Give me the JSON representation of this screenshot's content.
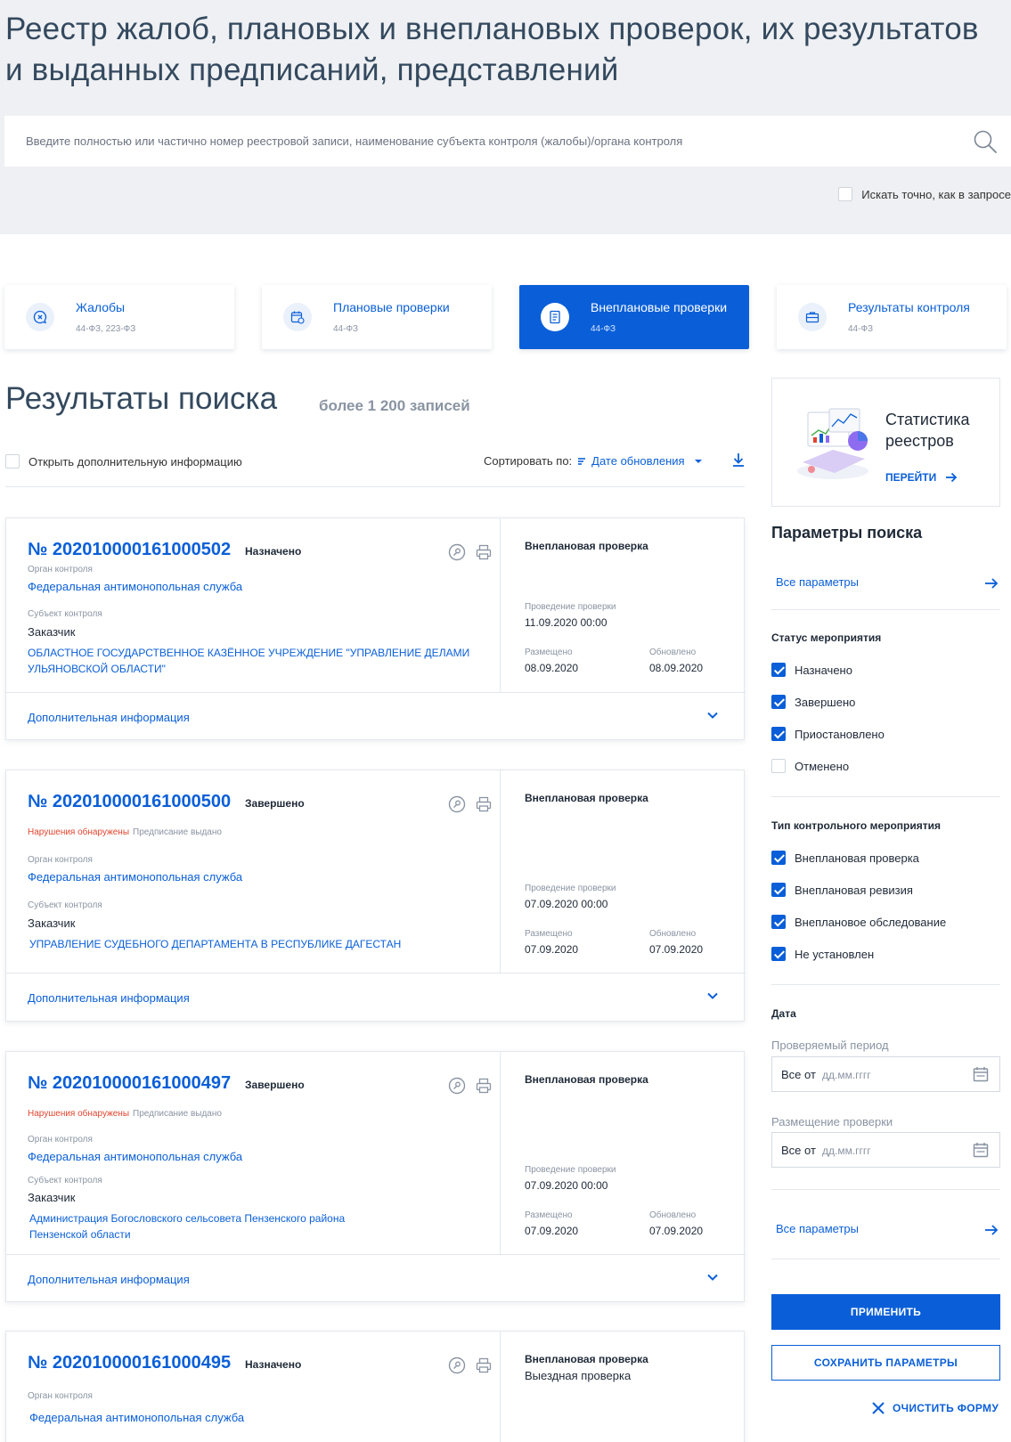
{
  "header": {
    "title": "Реестр жалоб, плановых и внеплановых проверок, их результатов и выданных предписаний, представлений",
    "search_placeholder": "Введите полностью или частично номер реестровой записи, наименование субъекта контроля (жалобы)/органа контроля",
    "exact_label": "Искать точно, как в запросе"
  },
  "tabs": [
    {
      "label": "Жалобы",
      "sub": "44-ФЗ, 223-ФЗ",
      "icon": "complaint-icon",
      "active": false
    },
    {
      "label": "Плановые проверки",
      "sub": "44-ФЗ",
      "icon": "calendar-icon",
      "active": false
    },
    {
      "label": "Внеплановые проверки",
      "sub": "44-ФЗ",
      "icon": "document-icon",
      "active": true
    },
    {
      "label": "Результаты контроля",
      "sub": "44-ФЗ",
      "icon": "briefcase-icon",
      "active": false
    }
  ],
  "results": {
    "title": "Результаты поиска",
    "count": "более 1 200 записей",
    "open_info_label": "Открыть дополнительную информацию",
    "sort_label": "Сортировать по:",
    "sort_value": "Дате обновления"
  },
  "card_labels": {
    "org_label": "Орган контроля",
    "subject_label": "Субъект контроля",
    "conduct_label": "Проведение проверки",
    "placed_label": "Размещено",
    "updated_label": "Обновлено",
    "more_info": "Дополнительная информация"
  },
  "cards": [
    {
      "number": "№ 202010000161000502",
      "status": "Назначено",
      "violation": "",
      "prescription": "",
      "org": "Федеральная антимонопольная служба",
      "subject_role": "Заказчик",
      "subject_name": "ОБЛАСТНОЕ ГОСУДАРСТВЕННОЕ КАЗЁННОЕ УЧРЕЖДЕНИЕ \"УПРАВЛЕНИЕ ДЕЛАМИ УЛЬЯНОВСКОЙ ОБЛАСТИ\"",
      "type": "Внеплановая проверка",
      "subtype": "",
      "conduct_date": "11.09.2020 00:00",
      "placed": "08.09.2020",
      "updated": "08.09.2020"
    },
    {
      "number": "№ 202010000161000500",
      "status": "Завершено",
      "violation": "Нарушения обнаружены",
      "prescription": "Предписание выдано",
      "org": "Федеральная антимонопольная служба",
      "subject_role": "Заказчик",
      "subject_name": "УПРАВЛЕНИЕ СУДЕБНОГО ДЕПАРТАМЕНТА В РЕСПУБЛИКЕ  ДАГЕСТАН",
      "type": "Внеплановая проверка",
      "subtype": "",
      "conduct_date": "07.09.2020 00:00",
      "placed": "07.09.2020",
      "updated": "07.09.2020"
    },
    {
      "number": "№ 202010000161000497",
      "status": "Завершено",
      "violation": "Нарушения обнаружены",
      "prescription": "Предписание выдано",
      "org": "Федеральная антимонопольная служба",
      "subject_role": "Заказчик",
      "subject_name": "Администрация Богословского сельсовета Пензенского района Пензенской области",
      "type": "Внеплановая проверка",
      "subtype": "",
      "conduct_date": "07.09.2020 00:00",
      "placed": "07.09.2020",
      "updated": "07.09.2020"
    },
    {
      "number": "№ 202010000161000495",
      "status": "Назначено",
      "violation": "",
      "prescription": "",
      "org": "Федеральная антимонопольная служба",
      "type": "Внеплановая проверка",
      "subtype": "Выездная проверка"
    }
  ],
  "sidebar": {
    "stats_title": "Статистика реестров",
    "stats_link": "ПЕРЕЙТИ",
    "params_title": "Параметры поиска",
    "all_params": "Все параметры",
    "status_group": "Статус мероприятия",
    "statuses": [
      {
        "label": "Назначено",
        "checked": true
      },
      {
        "label": "Завершено",
        "checked": true
      },
      {
        "label": "Приостановлено",
        "checked": true
      },
      {
        "label": "Отменено",
        "checked": false
      }
    ],
    "type_group": "Тип контрольного мероприятия",
    "types": [
      {
        "label": "Внеплановая проверка",
        "checked": true
      },
      {
        "label": "Внеплановая ревизия",
        "checked": true
      },
      {
        "label": "Внеплановое обследование",
        "checked": true
      },
      {
        "label": "Не установлен",
        "checked": true
      }
    ],
    "date_group": "Дата",
    "period_label": "Проверяемый период",
    "placement_label": "Размещение проверки",
    "from_label": "Все от",
    "date_placeholder": "дд.мм.гггг",
    "apply": "ПРИМЕНИТЬ",
    "save": "СОХРАНИТЬ ПАРАМЕТРЫ",
    "clear": "ОЧИСТИТЬ ФОРМУ"
  },
  "colors": {
    "accent": "#0a5fd8",
    "danger": "#e0452f",
    "muted": "#8a94a2"
  }
}
